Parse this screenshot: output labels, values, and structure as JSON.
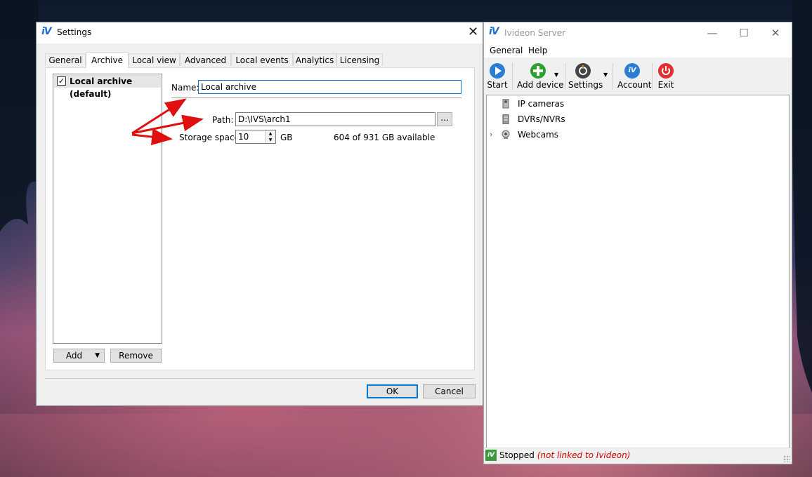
{
  "settings_dialog": {
    "title": "Settings",
    "logo_text": "iV",
    "tabs": [
      {
        "label": "General"
      },
      {
        "label": "Archive"
      },
      {
        "label": "Local view"
      },
      {
        "label": "Advanced"
      },
      {
        "label": "Local events"
      },
      {
        "label": "Analytics"
      },
      {
        "label": "Licensing"
      }
    ],
    "active_tab": "Archive",
    "archive_list": [
      {
        "label": "Local archive (default)",
        "checked": true
      }
    ],
    "add_button": "Add",
    "remove_button": "Remove",
    "form": {
      "name_label": "Name:",
      "name_value": "Local archive",
      "path_label": "Path:",
      "path_value": "D:\\IVS\\arch1",
      "browse_button": "...",
      "storage_label": "Storage space:",
      "storage_value": "10",
      "storage_unit": "GB",
      "available_text": "604 of 931 GB available"
    },
    "ok_button": "OK",
    "cancel_button": "Cancel"
  },
  "server_window": {
    "title": "Ivideon Server",
    "logo_text": "iV",
    "menu": [
      {
        "label": "General"
      },
      {
        "label": "Help"
      }
    ],
    "toolbar": [
      {
        "label": "Start",
        "icon": "play-icon",
        "color": "#2a7fd4"
      },
      {
        "label": "Add device",
        "icon": "plus-icon",
        "color": "#2ea12e"
      },
      {
        "label": "Settings",
        "icon": "wrench-icon",
        "color": "#555555"
      },
      {
        "label": "Account",
        "icon": "ivideon-icon",
        "color": "#2a7fd4"
      },
      {
        "label": "Exit",
        "icon": "power-icon",
        "color": "#e03030"
      }
    ],
    "tree": [
      {
        "label": "IP cameras",
        "icon": "ip-camera-icon"
      },
      {
        "label": "DVRs/NVRs",
        "icon": "dvr-icon"
      },
      {
        "label": "Webcams",
        "icon": "webcam-icon",
        "expandable": true
      }
    ],
    "status": {
      "logo_text": "iV",
      "state": "Stopped",
      "note": "(not linked to Ivideon)"
    }
  },
  "colors": {
    "accent": "#0078d7",
    "annotation_arrow": "#e01010",
    "status_note": "#d40000"
  }
}
